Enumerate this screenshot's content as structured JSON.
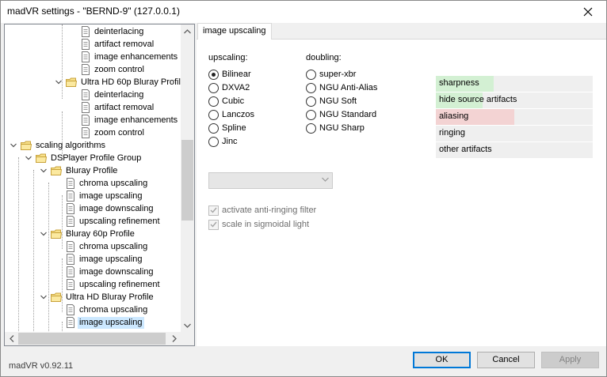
{
  "window": {
    "title": "madVR settings - \"BERND-9\" (127.0.0.1)"
  },
  "tree": {
    "items": [
      {
        "label": "deinterlacing"
      },
      {
        "label": "artifact removal"
      },
      {
        "label": "image enhancements"
      },
      {
        "label": "zoom control"
      },
      {
        "label": "Ultra HD 60p Bluray Profile"
      },
      {
        "label": "deinterlacing"
      },
      {
        "label": "artifact removal"
      },
      {
        "label": "image enhancements"
      },
      {
        "label": "zoom control"
      },
      {
        "label": "scaling algorithms"
      },
      {
        "label": "DSPlayer Profile Group"
      },
      {
        "label": "Bluray Profile"
      },
      {
        "label": "chroma upscaling"
      },
      {
        "label": "image upscaling"
      },
      {
        "label": "image downscaling"
      },
      {
        "label": "upscaling refinement"
      },
      {
        "label": "Bluray 60p Profile"
      },
      {
        "label": "chroma upscaling"
      },
      {
        "label": "image upscaling"
      },
      {
        "label": "image downscaling"
      },
      {
        "label": "upscaling refinement"
      },
      {
        "label": "Ultra HD Bluray Profile"
      },
      {
        "label": "chroma upscaling"
      },
      {
        "label": "image upscaling"
      }
    ],
    "selected": "image upscaling"
  },
  "tab": {
    "label": "image upscaling"
  },
  "upscaling": {
    "label": "upscaling:",
    "options": [
      "Bilinear",
      "DXVA2",
      "Cubic",
      "Lanczos",
      "Spline",
      "Jinc"
    ],
    "selected": "Bilinear"
  },
  "doubling": {
    "label": "doubling:",
    "options": [
      "super-xbr",
      "NGU Anti-Alias",
      "NGU Soft",
      "NGU Standard",
      "NGU Sharp"
    ]
  },
  "dropdown": {
    "value": ""
  },
  "checkboxes": {
    "anti_ringing": "activate anti-ringing filter",
    "sigmoidal": "scale in sigmoidal light"
  },
  "quality": [
    {
      "label": "sharpness",
      "level": 0.37,
      "color": "#d3f0d3"
    },
    {
      "label": "hide source artifacts",
      "level": 0.3,
      "color": "#d3f0d3"
    },
    {
      "label": "aliasing",
      "level": 0.5,
      "color": "#f3d3d3"
    },
    {
      "label": "ringing",
      "level": 0,
      "color": "#efefef"
    },
    {
      "label": "other artifacts",
      "level": 0,
      "color": "#efefef"
    }
  ],
  "footer": {
    "version": "madVR v0.92.11",
    "ok": "OK",
    "cancel": "Cancel",
    "apply": "Apply"
  }
}
